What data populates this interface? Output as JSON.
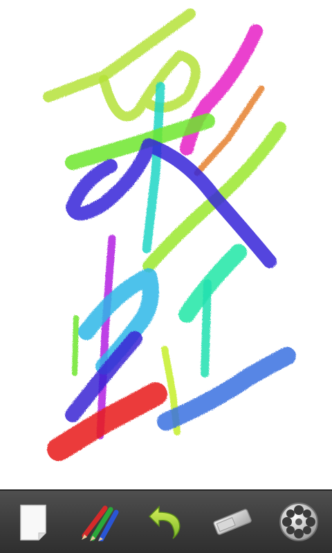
{
  "app": {
    "canvas_background": "#ffffff",
    "toolbar_background": "#3d3d3d"
  },
  "toolbar": {
    "items": [
      {
        "name": "new-page",
        "icon": "blank-page-icon"
      },
      {
        "name": "brush-colors",
        "icon": "colored-pencils-icon"
      },
      {
        "name": "undo",
        "icon": "undo-arrow-icon"
      },
      {
        "name": "eraser",
        "icon": "eraser-icon"
      },
      {
        "name": "playback",
        "icon": "film-reel-icon"
      }
    ]
  },
  "stroke_colors": {
    "lime": "#a6e22e",
    "green": "#6de82a",
    "cyan": "#1fd6c8",
    "sky": "#2fb8e6",
    "blue": "#3a6fe0",
    "indigo": "#3a2ad6",
    "magenta": "#e619c8",
    "violet": "#b020e0",
    "orange": "#e07a2a",
    "red": "#e81a1a",
    "teal": "#1ee6a8",
    "yellowgreen": "#c8f02a"
  }
}
